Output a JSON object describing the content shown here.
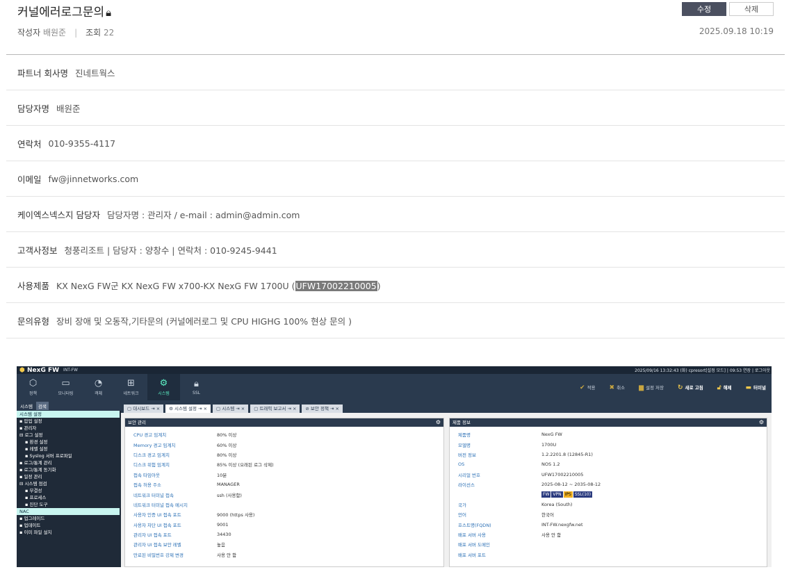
{
  "post": {
    "title": "커널에러로그문의",
    "lock_icon": "lock-icon",
    "edit_label": "수정",
    "delete_label": "삭제",
    "author_label": "작성자",
    "author": "배원준",
    "sep": "|",
    "views_label": "조회",
    "views": "22",
    "date": "2025.09.18 10:19"
  },
  "rows": [
    {
      "label": "파트너 회사명",
      "value": "진네트웍스"
    },
    {
      "label": "담당자명",
      "value": "배원준"
    },
    {
      "label": "연락처",
      "value": "010-9355-4117"
    },
    {
      "label": "이메일",
      "value": "fw@jinnetworks.com"
    },
    {
      "label": "케이엑스넥스지 담당자",
      "value": "담당자명 : 관리자 / e-mail : admin@admin.com"
    },
    {
      "label": "고객사정보",
      "value": "청풍리조트 | 담당자 : 양창수 | 연락처 : 010-9245-9441"
    },
    {
      "label": "사용제품",
      "value": "KX NexG FW군 KX NexG FW x700-KX NexG FW 1700U (",
      "highlight": "UFW17002210005",
      "value_end": ")"
    },
    {
      "label": "문의유형",
      "value": "장비 장애 및 오동작,기타문의 (커널에러로그 및 CPU HIGHG 100% 현상 문의 )"
    }
  ],
  "screenshot": {
    "logo": "NexG FW",
    "device": "INT-FW",
    "status": "2025/09/16 13:32:43 (화)   cpresort[설정 모드]  |  09:53 연장  |  로그아웃",
    "nav": [
      {
        "label": "정책",
        "icon": "shield-icon"
      },
      {
        "label": "모니터링",
        "icon": "monitor-icon"
      },
      {
        "label": "객체",
        "icon": "object-icon"
      },
      {
        "label": "네트워크",
        "icon": "network-icon"
      },
      {
        "label": "시스템",
        "icon": "gear-icon"
      },
      {
        "label": "SSL",
        "icon": "lock-icon"
      }
    ],
    "actions": [
      {
        "label": "적용",
        "icon": "check-icon"
      },
      {
        "label": "취소",
        "icon": "x-icon"
      },
      {
        "label": "설정 저장",
        "icon": "save-icon"
      },
      {
        "label": "새로 고침",
        "icon": "refresh-icon"
      },
      {
        "label": "해제",
        "icon": "unlock-icon"
      },
      {
        "label": "터미널",
        "icon": "terminal-icon"
      }
    ],
    "left_tabs": [
      "시스템",
      "검색"
    ],
    "left_items": [
      {
        "label": "시스템 설정",
        "sub": false,
        "selected": true
      },
      {
        "label": "▪ 압업 설정",
        "sub": false
      },
      {
        "label": "▪ 관리자",
        "sub": false
      },
      {
        "label": "⊟ 로그 설정",
        "sub": false
      },
      {
        "label": "▪ 환경 설정",
        "sub": true
      },
      {
        "label": "▪ 레벨 설정",
        "sub": true
      },
      {
        "label": "▪ Syslog 서버 프로파일",
        "sub": true
      },
      {
        "label": "▪ 로그/통계 관리",
        "sub": false
      },
      {
        "label": "▪ 로그/통계 동기화",
        "sub": false
      },
      {
        "label": "▪ 일정 관리",
        "sub": false
      },
      {
        "label": "⊟ 시스템 점검",
        "sub": false
      },
      {
        "label": "▪ 무결성",
        "sub": true
      },
      {
        "label": "▪ 프로세스",
        "sub": true
      },
      {
        "label": "▪ 진단 도구",
        "sub": true
      },
      {
        "label": "NAC",
        "sub": false,
        "selected": true
      },
      {
        "label": "▪ 업그레이드",
        "sub": false
      },
      {
        "label": "▪ 업데이트",
        "sub": false
      },
      {
        "label": "▪ 이미 파일 설치",
        "sub": false
      }
    ],
    "tabs": [
      "▢ 대시보드 ⇥ ×",
      "⚙ 시스템 설정 ⇥ ×",
      "▢ 시스템 ⇥ ×",
      "▢ 트래픽 보고서 ⇥ ×",
      "⊘ 보안 정책 ⇥ ×"
    ],
    "security": {
      "title": "보안 관리",
      "rows": [
        [
          "CPU 경고 임계치",
          "80% 이상"
        ],
        [
          "Memory 경고 임계치",
          "60% 이상"
        ],
        [
          "디스크 경고 임계치",
          "80% 이상"
        ],
        [
          "디스크 위험 임계치",
          "85% 이상 (오래된 로그 삭제)"
        ],
        [
          "접속 타임아웃",
          "10분"
        ],
        [
          "접속 허용 주소",
          "MANAGER"
        ],
        [
          "네트워크 터미널 접속",
          "ssh (사용함)"
        ],
        [
          "네트워크 터미널 접속 메시지",
          ""
        ],
        [
          "사용자 인증 UI 접속 포트",
          "9000 (https 사용)"
        ],
        [
          "사용자 차단 UI 접속 포트",
          "9001"
        ],
        [
          "관리자 UI 접속 포트",
          "34430"
        ],
        [
          "관리자 UI 접속 보안 레벨",
          "높음"
        ],
        [
          "만료된 비밀번호 강제 변경",
          "사용 안 함"
        ]
      ]
    },
    "product": {
      "title": "제품 정보",
      "rows": [
        [
          "제품명",
          "NexG FW"
        ],
        [
          "모델명",
          "1700U"
        ],
        [
          "버전 정보",
          "1.2.2201.8 (12845-R1)"
        ],
        [
          "OS",
          "NOS 1.2"
        ],
        [
          "시리얼 번호",
          "UFW17002210005"
        ],
        [
          "라이선스",
          "2025-08-12 ~ 2035-08-12"
        ],
        [
          "",
          ""
        ],
        [
          "국가",
          "Korea (South)"
        ],
        [
          "언어",
          "한국어"
        ],
        [
          "호스트명(FQDN)",
          "INT-FW.nexgfw.net"
        ],
        [
          "배포 서버 사용",
          "사용 안 함"
        ],
        [
          "배포 서버 도메인",
          ""
        ],
        [
          "배포 서버 포트",
          ""
        ]
      ],
      "licenses": [
        "FW",
        "VPN",
        "IPS",
        "SSL(10)"
      ]
    }
  },
  "colors": {
    "accent": "#5cf0c4",
    "nav_bg": "#2a3a4e",
    "edit_btn": "#4b5060"
  }
}
